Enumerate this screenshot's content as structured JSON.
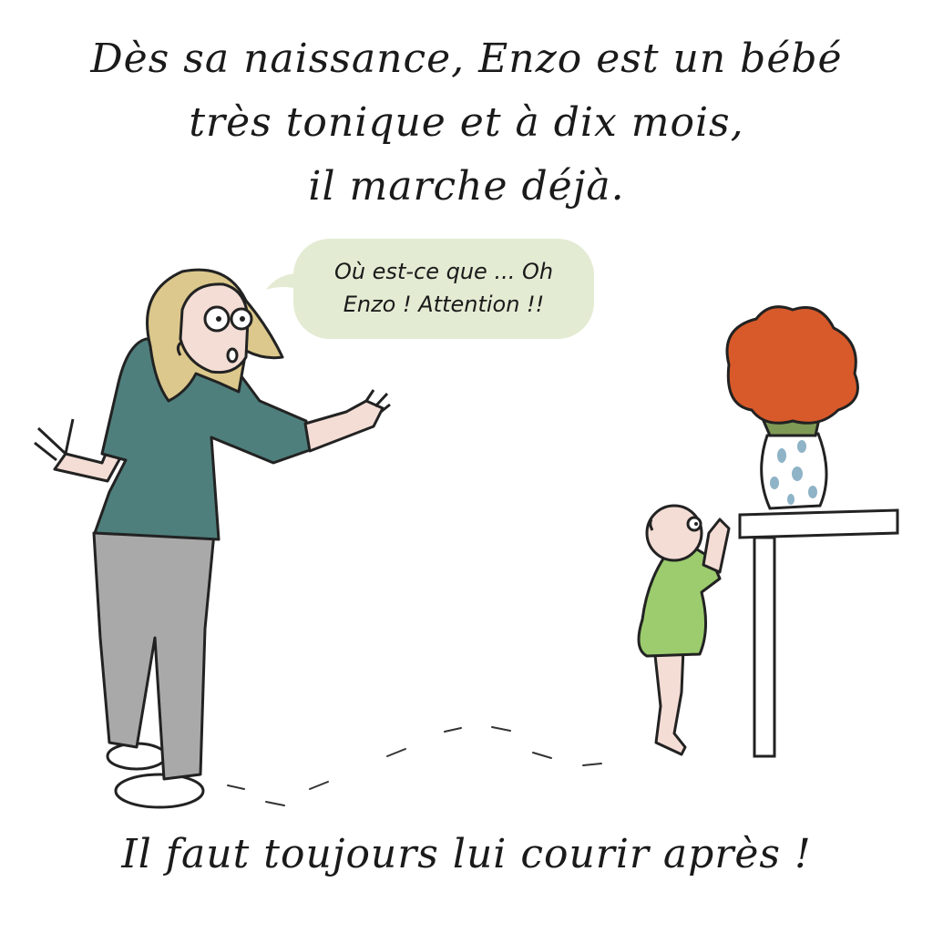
{
  "caption_top": {
    "line1": "Dès sa naissance, Enzo est un bébé",
    "line2": "très tonique et à dix mois,",
    "line3": "il marche déjà."
  },
  "speech_bubble": {
    "line1": "Où est-ce que ... Oh",
    "line2": "Enzo ! Attention !!"
  },
  "caption_bottom": "Il faut toujours lui courir après !",
  "colors": {
    "bubble": "#e4ebd3",
    "shirt": "#4e7f7c",
    "pants": "#a9a9a9",
    "hair": "#dcc88c",
    "skin": "#f4ddd5",
    "baby_outfit": "#9ccc6e",
    "flowers": "#d85a2a",
    "vase_spots": "#8fb3c7"
  }
}
